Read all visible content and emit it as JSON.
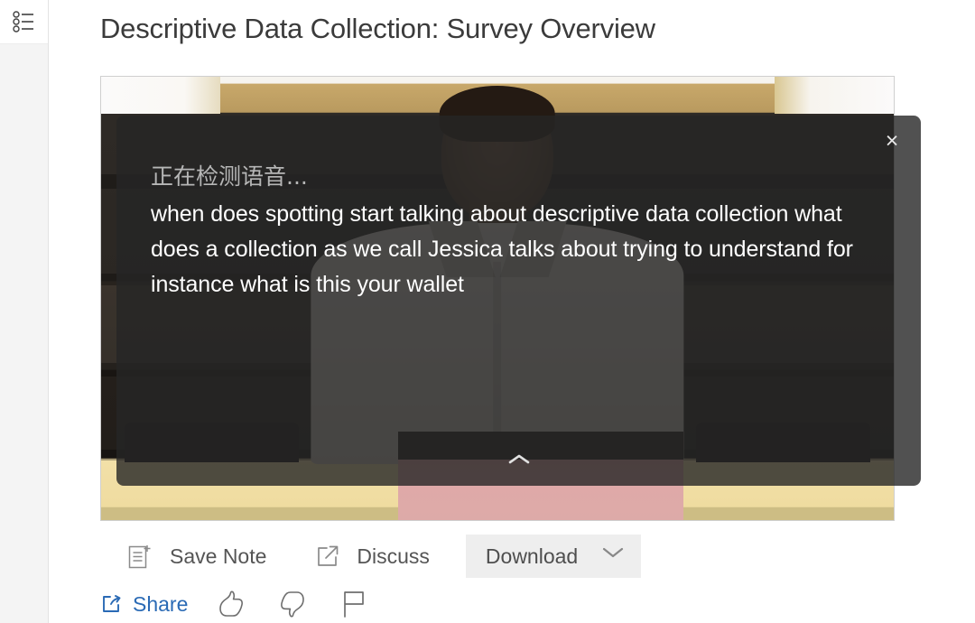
{
  "sidebar": {
    "list_icon": "bulleted-list-icon"
  },
  "header": {
    "title": "Descriptive Data Collection: Survey Overview"
  },
  "video": {
    "alt": "lecture video still of a speaker in a lecture hall"
  },
  "overlay": {
    "close_label": "×",
    "status": "正在检测语音...",
    "transcript": "when does spotting start talking about descriptive data collection what does a collection as we call Jessica talks about trying to understand for instance what is this your wallet",
    "collapse_icon": "chevron-up-icon"
  },
  "actions": {
    "save_note": {
      "label": "Save Note",
      "icon": "note-add-icon"
    },
    "discuss": {
      "label": "Discuss",
      "icon": "external-link-icon"
    },
    "download": {
      "label": "Download",
      "icon": "chevron-down-icon"
    }
  },
  "share_row": {
    "share": {
      "label": "Share",
      "icon": "share-icon"
    },
    "thumbs_up": {
      "icon": "thumbs-up-icon"
    },
    "thumbs_down": {
      "icon": "thumbs-down-icon"
    },
    "flag": {
      "icon": "flag-icon"
    }
  },
  "colors": {
    "link_blue": "#2a6ab5",
    "text_gray": "#555555",
    "title_gray": "#3b3b3b",
    "button_bg": "#eeeeee",
    "overlay_bg": "rgba(38,38,38,0.80)"
  }
}
